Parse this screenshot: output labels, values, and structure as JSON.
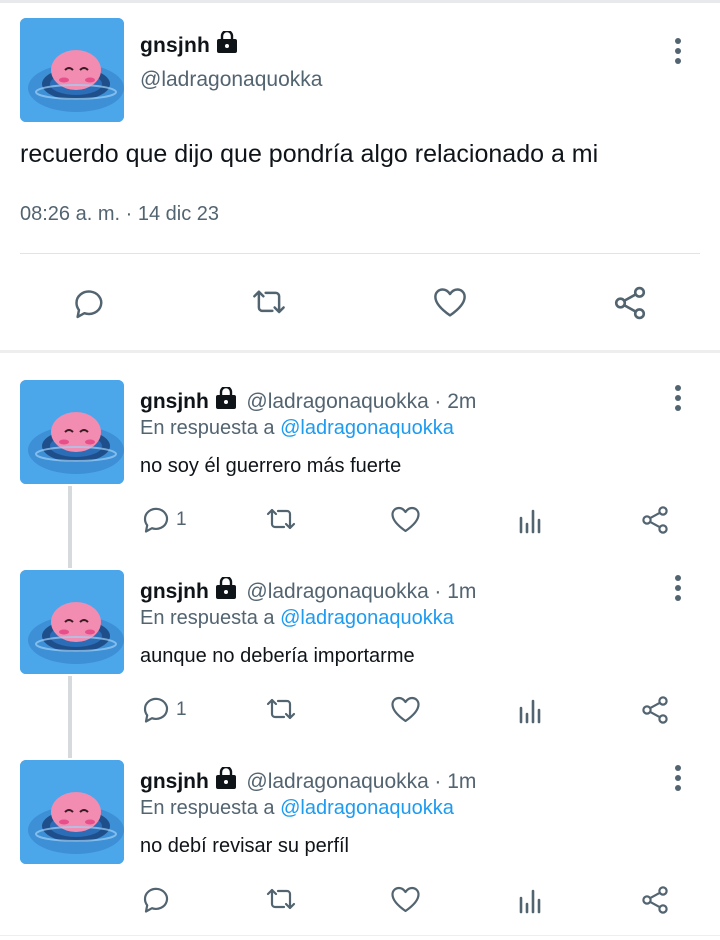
{
  "main_tweet": {
    "display_name": "gnsjnh",
    "handle": "@ladragonaquokka",
    "text": "recuerdo que dijo que pondría algo relacionado a mi",
    "timestamp": "08:26 a. m. · 14 dic 23"
  },
  "replies": [
    {
      "display_name": "gnsjnh",
      "handle": "@ladragonaquokka",
      "time": "· 2m",
      "reply_prefix": "En respuesta a",
      "reply_to": "@ladragonaquokka",
      "text": "no soy él guerrero más fuerte",
      "reply_count": "1"
    },
    {
      "display_name": "gnsjnh",
      "handle": "@ladragonaquokka",
      "time": "· 1m",
      "reply_prefix": "En respuesta a",
      "reply_to": "@ladragonaquokka",
      "text": "aunque no debería importarme",
      "reply_count": "1"
    },
    {
      "display_name": "gnsjnh",
      "handle": "@ladragonaquokka",
      "time": "· 1m",
      "reply_prefix": "En respuesta a",
      "reply_to": "@ladragonaquokka",
      "text": "no debí revisar su perfíl",
      "reply_count": ""
    }
  ],
  "icons": [
    "lock-icon",
    "more-icon",
    "reply-icon",
    "retweet-icon",
    "like-icon",
    "share-icon",
    "analytics-icon"
  ],
  "colors": {
    "link": "#1d9bf0",
    "muted": "#536471",
    "avatar_bg": "#4ca6ea",
    "avatar_character": "#f28cb0"
  }
}
